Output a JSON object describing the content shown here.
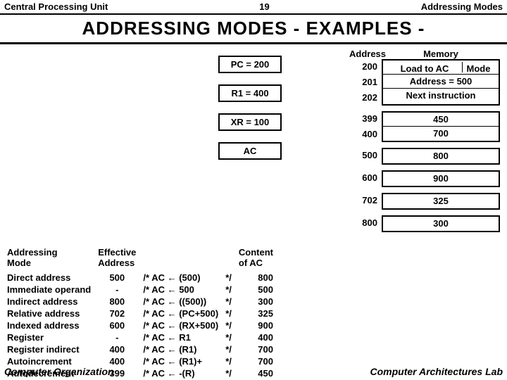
{
  "header": {
    "left": "Central Processing Unit",
    "page": "19",
    "right": "Addressing Modes"
  },
  "title": "ADDRESSING  MODES    - EXAMPLES -",
  "registers": {
    "pc": "PC = 200",
    "r1": "R1 = 400",
    "xr": "XR = 100",
    "ac": "AC"
  },
  "memory": {
    "addr_header": "Address",
    "mem_header": "Memory",
    "blocks": [
      {
        "rows": [
          {
            "addr": "200",
            "split": [
              "Load to AC",
              "Mode"
            ]
          },
          {
            "addr": "201",
            "val": "Address = 500"
          },
          {
            "addr": "202",
            "val": "Next instruction"
          }
        ]
      },
      {
        "rows": [
          {
            "addr": "399",
            "val": "450"
          },
          {
            "addr": "400",
            "val": "700"
          }
        ]
      },
      {
        "rows": [
          {
            "addr": "500",
            "val": "800"
          }
        ]
      },
      {
        "rows": [
          {
            "addr": "600",
            "val": "900"
          }
        ]
      },
      {
        "rows": [
          {
            "addr": "702",
            "val": "325"
          }
        ]
      },
      {
        "rows": [
          {
            "addr": "800",
            "val": "300"
          }
        ]
      }
    ]
  },
  "table": {
    "h_mode": "Addressing\nMode",
    "h_eff": "Effective\nAddress",
    "h_content": "Content\nof AC",
    "rows": [
      {
        "mode": "Direct address",
        "eff": "500",
        "calc": "/* AC ← (500)",
        "end": "*/",
        "content": "800"
      },
      {
        "mode": "Immediate operand",
        "eff": "-",
        "calc": "/* AC ← 500",
        "end": "*/",
        "content": "500"
      },
      {
        "mode": "Indirect address",
        "eff": "800",
        "calc": "/* AC ← ((500))",
        "end": "*/",
        "content": "300"
      },
      {
        "mode": "Relative address",
        "eff": "702",
        "calc": "/* AC ← (PC+500)",
        "end": "*/",
        "content": "325"
      },
      {
        "mode": "Indexed address",
        "eff": "600",
        "calc": "/* AC ← (RX+500)",
        "end": "*/",
        "content": "900"
      },
      {
        "mode": "Register",
        "eff": "-",
        "calc": "/* AC ← R1",
        "end": "*/",
        "content": "400"
      },
      {
        "mode": "Register indirect",
        "eff": "400",
        "calc": "/* AC ← (R1)",
        "end": "*/",
        "content": "700"
      },
      {
        "mode": "Autoincrement",
        "eff": "400",
        "calc": "/* AC ← (R1)+",
        "end": "*/",
        "content": "700"
      },
      {
        "mode": "Autodecrement",
        "eff": "399",
        "calc": "/* AC ← -(R)",
        "end": "*/",
        "content": "450"
      }
    ]
  },
  "footer": {
    "left": "Computer Organization",
    "right": "Computer Architectures Lab"
  }
}
